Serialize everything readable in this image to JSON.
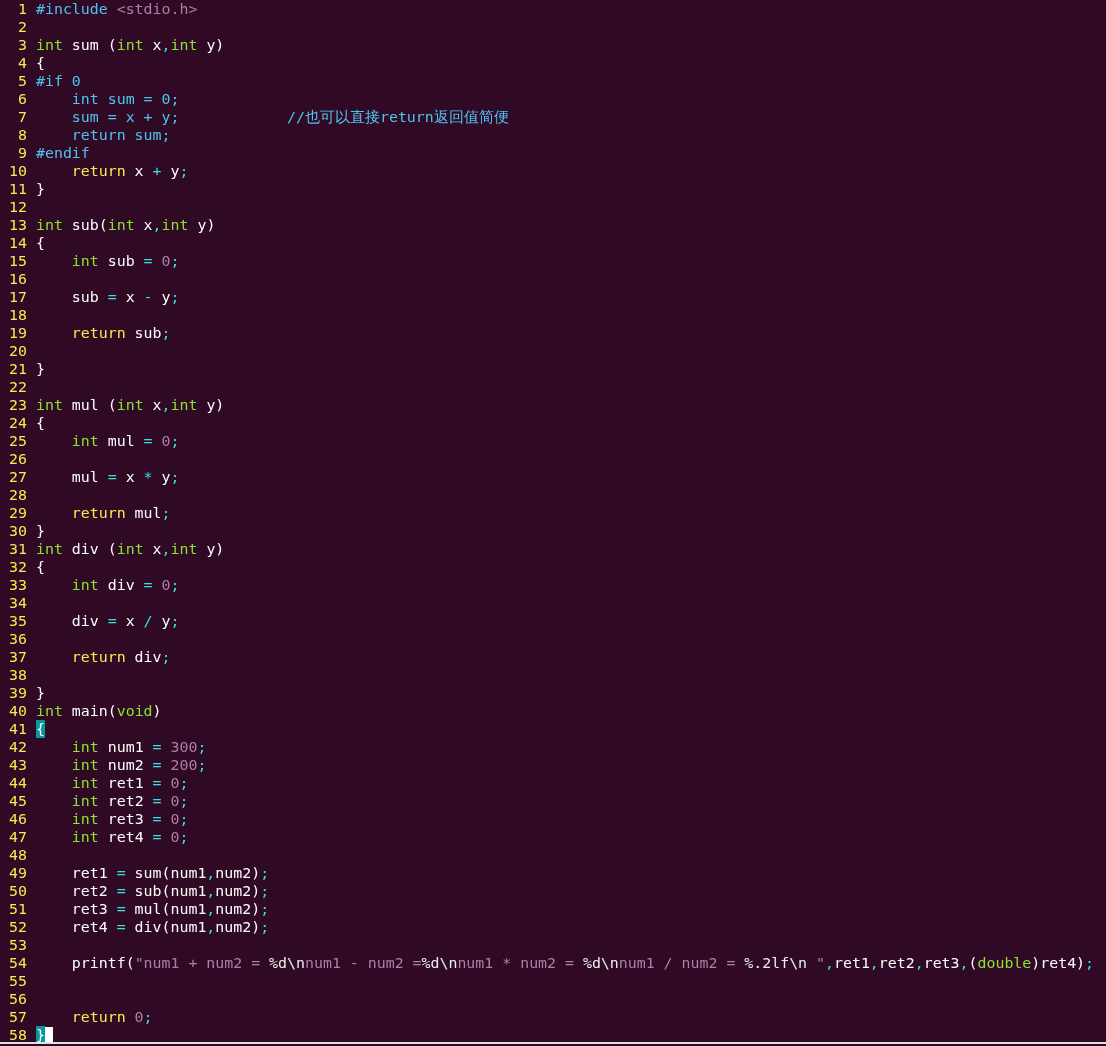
{
  "lines": [
    {
      "number": "1",
      "cursor": false,
      "segments": [
        {
          "kind": "preproc",
          "text": "#include "
        },
        {
          "kind": "string",
          "text": "<stdio.h>"
        }
      ]
    },
    {
      "number": "2",
      "cursor": false
    },
    {
      "number": "3",
      "cursor": false,
      "segments": [
        {
          "kind": "type",
          "text": "int"
        },
        {
          "kind": "plain",
          "text": " sum ("
        },
        {
          "kind": "type",
          "text": "int"
        },
        {
          "kind": "plain",
          "text": " x"
        },
        {
          "kind": "op",
          "text": ","
        },
        {
          "kind": "type",
          "text": "int"
        },
        {
          "kind": "plain",
          "text": " y)"
        }
      ]
    },
    {
      "number": "4",
      "cursor": false,
      "segments": [
        {
          "kind": "plain",
          "text": "{"
        }
      ]
    },
    {
      "number": "5",
      "cursor": false,
      "segments": [
        {
          "kind": "preproc",
          "text": "#if 0"
        }
      ]
    },
    {
      "number": "6",
      "cursor": false,
      "segments": [
        {
          "kind": "preproc",
          "text": "    int sum = 0;"
        }
      ]
    },
    {
      "number": "7",
      "cursor": false,
      "segments": [
        {
          "kind": "preproc",
          "text": "    sum = x + y;            //也可以直接return返回值简便"
        }
      ]
    },
    {
      "number": "8",
      "cursor": false,
      "segments": [
        {
          "kind": "preproc",
          "text": "    return sum;"
        }
      ]
    },
    {
      "number": "9",
      "cursor": false,
      "segments": [
        {
          "kind": "preproc",
          "text": "#endif"
        }
      ]
    },
    {
      "number": "10",
      "cursor": false,
      "segments": [
        {
          "kind": "keyword",
          "text": "    return"
        },
        {
          "kind": "plain",
          "text": " x "
        },
        {
          "kind": "op",
          "text": "+"
        },
        {
          "kind": "plain",
          "text": " y"
        },
        {
          "kind": "op",
          "text": ";"
        }
      ]
    },
    {
      "number": "11",
      "cursor": false,
      "segments": [
        {
          "kind": "plain",
          "text": "}"
        }
      ]
    },
    {
      "number": "12",
      "cursor": false
    },
    {
      "number": "13",
      "cursor": false,
      "segments": [
        {
          "kind": "type",
          "text": "int"
        },
        {
          "kind": "plain",
          "text": " sub("
        },
        {
          "kind": "type",
          "text": "int"
        },
        {
          "kind": "plain",
          "text": " x"
        },
        {
          "kind": "op",
          "text": ","
        },
        {
          "kind": "type",
          "text": "int"
        },
        {
          "kind": "plain",
          "text": " y)"
        }
      ]
    },
    {
      "number": "14",
      "cursor": false,
      "segments": [
        {
          "kind": "plain",
          "text": "{"
        }
      ]
    },
    {
      "number": "15",
      "cursor": false,
      "segments": [
        {
          "kind": "type",
          "text": "    int"
        },
        {
          "kind": "plain",
          "text": " sub "
        },
        {
          "kind": "op",
          "text": "="
        },
        {
          "kind": "num",
          "text": " 0"
        },
        {
          "kind": "op",
          "text": ";"
        }
      ]
    },
    {
      "number": "16",
      "cursor": false
    },
    {
      "number": "17",
      "cursor": false,
      "segments": [
        {
          "kind": "plain",
          "text": "    sub "
        },
        {
          "kind": "op",
          "text": "="
        },
        {
          "kind": "plain",
          "text": " x "
        },
        {
          "kind": "op",
          "text": "-"
        },
        {
          "kind": "plain",
          "text": " y"
        },
        {
          "kind": "op",
          "text": ";"
        }
      ]
    },
    {
      "number": "18",
      "cursor": false
    },
    {
      "number": "19",
      "cursor": false,
      "segments": [
        {
          "kind": "keyword",
          "text": "    return"
        },
        {
          "kind": "plain",
          "text": " sub"
        },
        {
          "kind": "op",
          "text": ";"
        }
      ]
    },
    {
      "number": "20",
      "cursor": false
    },
    {
      "number": "21",
      "cursor": false,
      "segments": [
        {
          "kind": "plain",
          "text": "}"
        }
      ]
    },
    {
      "number": "22",
      "cursor": false
    },
    {
      "number": "23",
      "cursor": false,
      "segments": [
        {
          "kind": "type",
          "text": "int"
        },
        {
          "kind": "plain",
          "text": " mul ("
        },
        {
          "kind": "type",
          "text": "int"
        },
        {
          "kind": "plain",
          "text": " x"
        },
        {
          "kind": "op",
          "text": ","
        },
        {
          "kind": "type",
          "text": "int"
        },
        {
          "kind": "plain",
          "text": " y)"
        }
      ]
    },
    {
      "number": "24",
      "cursor": false,
      "segments": [
        {
          "kind": "plain",
          "text": "{"
        }
      ]
    },
    {
      "number": "25",
      "cursor": false,
      "segments": [
        {
          "kind": "type",
          "text": "    int"
        },
        {
          "kind": "plain",
          "text": " mul "
        },
        {
          "kind": "op",
          "text": "="
        },
        {
          "kind": "num",
          "text": " 0"
        },
        {
          "kind": "op",
          "text": ";"
        }
      ]
    },
    {
      "number": "26",
      "cursor": false
    },
    {
      "number": "27",
      "cursor": false,
      "segments": [
        {
          "kind": "plain",
          "text": "    mul "
        },
        {
          "kind": "op",
          "text": "="
        },
        {
          "kind": "plain",
          "text": " x "
        },
        {
          "kind": "op",
          "text": "*"
        },
        {
          "kind": "plain",
          "text": " y"
        },
        {
          "kind": "op",
          "text": ";"
        }
      ]
    },
    {
      "number": "28",
      "cursor": false
    },
    {
      "number": "29",
      "cursor": false,
      "segments": [
        {
          "kind": "keyword",
          "text": "    return"
        },
        {
          "kind": "plain",
          "text": " mul"
        },
        {
          "kind": "op",
          "text": ";"
        }
      ]
    },
    {
      "number": "30",
      "cursor": false,
      "segments": [
        {
          "kind": "plain",
          "text": "}"
        }
      ]
    },
    {
      "number": "31",
      "cursor": false,
      "segments": [
        {
          "kind": "type",
          "text": "int"
        },
        {
          "kind": "plain",
          "text": " div ("
        },
        {
          "kind": "type",
          "text": "int"
        },
        {
          "kind": "plain",
          "text": " x"
        },
        {
          "kind": "op",
          "text": ","
        },
        {
          "kind": "type",
          "text": "int"
        },
        {
          "kind": "plain",
          "text": " y)"
        }
      ]
    },
    {
      "number": "32",
      "cursor": false,
      "segments": [
        {
          "kind": "plain",
          "text": "{"
        }
      ]
    },
    {
      "number": "33",
      "cursor": false,
      "segments": [
        {
          "kind": "type",
          "text": "    int"
        },
        {
          "kind": "plain",
          "text": " div "
        },
        {
          "kind": "op",
          "text": "="
        },
        {
          "kind": "num",
          "text": " 0"
        },
        {
          "kind": "op",
          "text": ";"
        }
      ]
    },
    {
      "number": "34",
      "cursor": false
    },
    {
      "number": "35",
      "cursor": false,
      "segments": [
        {
          "kind": "plain",
          "text": "    div "
        },
        {
          "kind": "op",
          "text": "="
        },
        {
          "kind": "plain",
          "text": " x "
        },
        {
          "kind": "op",
          "text": "/"
        },
        {
          "kind": "plain",
          "text": " y"
        },
        {
          "kind": "op",
          "text": ";"
        }
      ]
    },
    {
      "number": "36",
      "cursor": false
    },
    {
      "number": "37",
      "cursor": false,
      "segments": [
        {
          "kind": "keyword",
          "text": "    return"
        },
        {
          "kind": "plain",
          "text": " div"
        },
        {
          "kind": "op",
          "text": ";"
        }
      ]
    },
    {
      "number": "38",
      "cursor": false
    },
    {
      "number": "39",
      "cursor": false,
      "segments": [
        {
          "kind": "plain",
          "text": "}"
        }
      ]
    },
    {
      "number": "40",
      "cursor": false,
      "segments": [
        {
          "kind": "type",
          "text": "int"
        },
        {
          "kind": "plain",
          "text": " main("
        },
        {
          "kind": "type",
          "text": "void"
        },
        {
          "kind": "plain",
          "text": ")"
        }
      ]
    },
    {
      "number": "41",
      "cursor": false,
      "segments": [
        {
          "kind": "match",
          "text": "{"
        }
      ]
    },
    {
      "number": "42",
      "cursor": false,
      "segments": [
        {
          "kind": "type",
          "text": "    int"
        },
        {
          "kind": "plain",
          "text": " num1 "
        },
        {
          "kind": "op",
          "text": "="
        },
        {
          "kind": "num",
          "text": " 300"
        },
        {
          "kind": "op",
          "text": ";"
        }
      ]
    },
    {
      "number": "43",
      "cursor": false,
      "segments": [
        {
          "kind": "type",
          "text": "    int"
        },
        {
          "kind": "plain",
          "text": " num2 "
        },
        {
          "kind": "op",
          "text": "="
        },
        {
          "kind": "num",
          "text": " 200"
        },
        {
          "kind": "op",
          "text": ";"
        }
      ]
    },
    {
      "number": "44",
      "cursor": false,
      "segments": [
        {
          "kind": "type",
          "text": "    int"
        },
        {
          "kind": "plain",
          "text": " ret1 "
        },
        {
          "kind": "op",
          "text": "="
        },
        {
          "kind": "num",
          "text": " 0"
        },
        {
          "kind": "op",
          "text": ";"
        }
      ]
    },
    {
      "number": "45",
      "cursor": false,
      "segments": [
        {
          "kind": "type",
          "text": "    int"
        },
        {
          "kind": "plain",
          "text": " ret2 "
        },
        {
          "kind": "op",
          "text": "="
        },
        {
          "kind": "num",
          "text": " 0"
        },
        {
          "kind": "op",
          "text": ";"
        }
      ]
    },
    {
      "number": "46",
      "cursor": false,
      "segments": [
        {
          "kind": "type",
          "text": "    int"
        },
        {
          "kind": "plain",
          "text": " ret3 "
        },
        {
          "kind": "op",
          "text": "="
        },
        {
          "kind": "num",
          "text": " 0"
        },
        {
          "kind": "op",
          "text": ";"
        }
      ]
    },
    {
      "number": "47",
      "cursor": false,
      "segments": [
        {
          "kind": "type",
          "text": "    int"
        },
        {
          "kind": "plain",
          "text": " ret4 "
        },
        {
          "kind": "op",
          "text": "="
        },
        {
          "kind": "num",
          "text": " 0"
        },
        {
          "kind": "op",
          "text": ";"
        }
      ]
    },
    {
      "number": "48",
      "cursor": false
    },
    {
      "number": "49",
      "cursor": false,
      "segments": [
        {
          "kind": "plain",
          "text": "    ret1 "
        },
        {
          "kind": "op",
          "text": "="
        },
        {
          "kind": "plain",
          "text": " sum(num1"
        },
        {
          "kind": "op",
          "text": ","
        },
        {
          "kind": "plain",
          "text": "num2)"
        },
        {
          "kind": "op",
          "text": ";"
        }
      ]
    },
    {
      "number": "50",
      "cursor": false,
      "segments": [
        {
          "kind": "plain",
          "text": "    ret2 "
        },
        {
          "kind": "op",
          "text": "="
        },
        {
          "kind": "plain",
          "text": " sub(num1"
        },
        {
          "kind": "op",
          "text": ","
        },
        {
          "kind": "plain",
          "text": "num2)"
        },
        {
          "kind": "op",
          "text": ";"
        }
      ]
    },
    {
      "number": "51",
      "cursor": false,
      "segments": [
        {
          "kind": "plain",
          "text": "    ret3 "
        },
        {
          "kind": "op",
          "text": "="
        },
        {
          "kind": "plain",
          "text": " mul(num1"
        },
        {
          "kind": "op",
          "text": ","
        },
        {
          "kind": "plain",
          "text": "num2)"
        },
        {
          "kind": "op",
          "text": ";"
        }
      ]
    },
    {
      "number": "52",
      "cursor": false,
      "segments": [
        {
          "kind": "plain",
          "text": "    ret4 "
        },
        {
          "kind": "op",
          "text": "="
        },
        {
          "kind": "plain",
          "text": " div(num1"
        },
        {
          "kind": "op",
          "text": ","
        },
        {
          "kind": "plain",
          "text": "num2)"
        },
        {
          "kind": "op",
          "text": ";"
        }
      ]
    },
    {
      "number": "53",
      "cursor": false
    },
    {
      "number": "54",
      "cursor": false,
      "segments": [
        {
          "kind": "plain",
          "text": "    printf("
        },
        {
          "kind": "string",
          "text": "\"num1 + num2 = "
        },
        {
          "kind": "special",
          "text": "%d\\n"
        },
        {
          "kind": "string",
          "text": "num1 - num2 ="
        },
        {
          "kind": "special",
          "text": "%d\\n"
        },
        {
          "kind": "string",
          "text": "num1 * num2 = "
        },
        {
          "kind": "special",
          "text": "%d\\n"
        },
        {
          "kind": "string",
          "text": "num1 / num2 = "
        },
        {
          "kind": "special",
          "text": "%.2lf\\n"
        },
        {
          "kind": "string",
          "text": " \""
        },
        {
          "kind": "op",
          "text": ","
        },
        {
          "kind": "plain",
          "text": "ret1"
        },
        {
          "kind": "op",
          "text": ","
        },
        {
          "kind": "plain",
          "text": "ret2"
        },
        {
          "kind": "op",
          "text": ","
        },
        {
          "kind": "plain",
          "text": "ret3"
        },
        {
          "kind": "op",
          "text": ","
        },
        {
          "kind": "plain",
          "text": "("
        },
        {
          "kind": "type",
          "text": "double"
        },
        {
          "kind": "plain",
          "text": ")ret4)"
        },
        {
          "kind": "op",
          "text": ";"
        }
      ]
    },
    {
      "number": "55",
      "cursor": false
    },
    {
      "number": "56",
      "cursor": false
    },
    {
      "number": "57",
      "cursor": false,
      "segments": [
        {
          "kind": "keyword",
          "text": "    return"
        },
        {
          "kind": "num",
          "text": " 0"
        },
        {
          "kind": "op",
          "text": ";"
        }
      ]
    },
    {
      "number": "58",
      "cursor": true,
      "segments": [
        {
          "kind": "match",
          "text": "}"
        }
      ]
    }
  ]
}
